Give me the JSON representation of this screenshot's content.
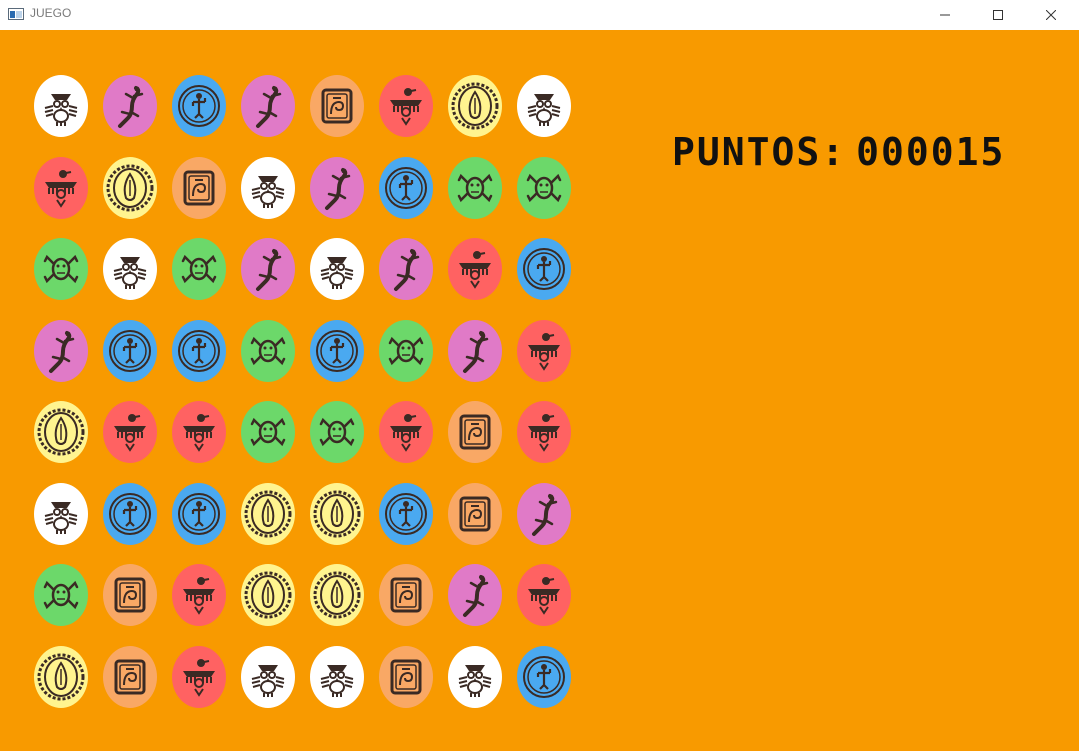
{
  "window": {
    "title": "JUEGO",
    "icons": {
      "app": "app-window-icon",
      "minimize": "minimize-icon",
      "maximize": "maximize-icon",
      "close": "close-icon"
    }
  },
  "score": {
    "label": "PUNTOS:",
    "value": "000015"
  },
  "colors": {
    "background": "#f89a00",
    "white": "#ffffff",
    "pink": "#e07ac7",
    "blue": "#4aa9f0",
    "peach": "#f9a865",
    "red": "#ff6262",
    "yellow": "#fff48f",
    "green": "#6cd86a"
  },
  "tile_symbols": {
    "white": "owl-glyph",
    "pink": "lizard-glyph",
    "blue": "figure-medallion-glyph",
    "peach": "spiral-square-glyph",
    "red": "bird-glyph",
    "yellow": "sun-seed-glyph",
    "green": "frog-glyph"
  },
  "board": [
    [
      "white",
      "pink",
      "blue",
      "pink",
      "peach",
      "red",
      "yellow",
      "white"
    ],
    [
      "red",
      "yellow",
      "peach",
      "white",
      "pink",
      "blue",
      "green",
      "green"
    ],
    [
      "green",
      "white",
      "green",
      "pink",
      "white",
      "pink",
      "red",
      "blue"
    ],
    [
      "pink",
      "blue",
      "blue",
      "green",
      "blue",
      "green",
      "pink",
      "red"
    ],
    [
      "yellow",
      "red",
      "red",
      "green",
      "green",
      "red",
      "peach",
      "red"
    ],
    [
      "white",
      "blue",
      "blue",
      "yellow",
      "yellow",
      "blue",
      "peach",
      "pink"
    ],
    [
      "green",
      "peach",
      "red",
      "yellow",
      "yellow",
      "peach",
      "pink",
      "red"
    ],
    [
      "yellow",
      "peach",
      "red",
      "white",
      "white",
      "peach",
      "white",
      "blue"
    ]
  ]
}
